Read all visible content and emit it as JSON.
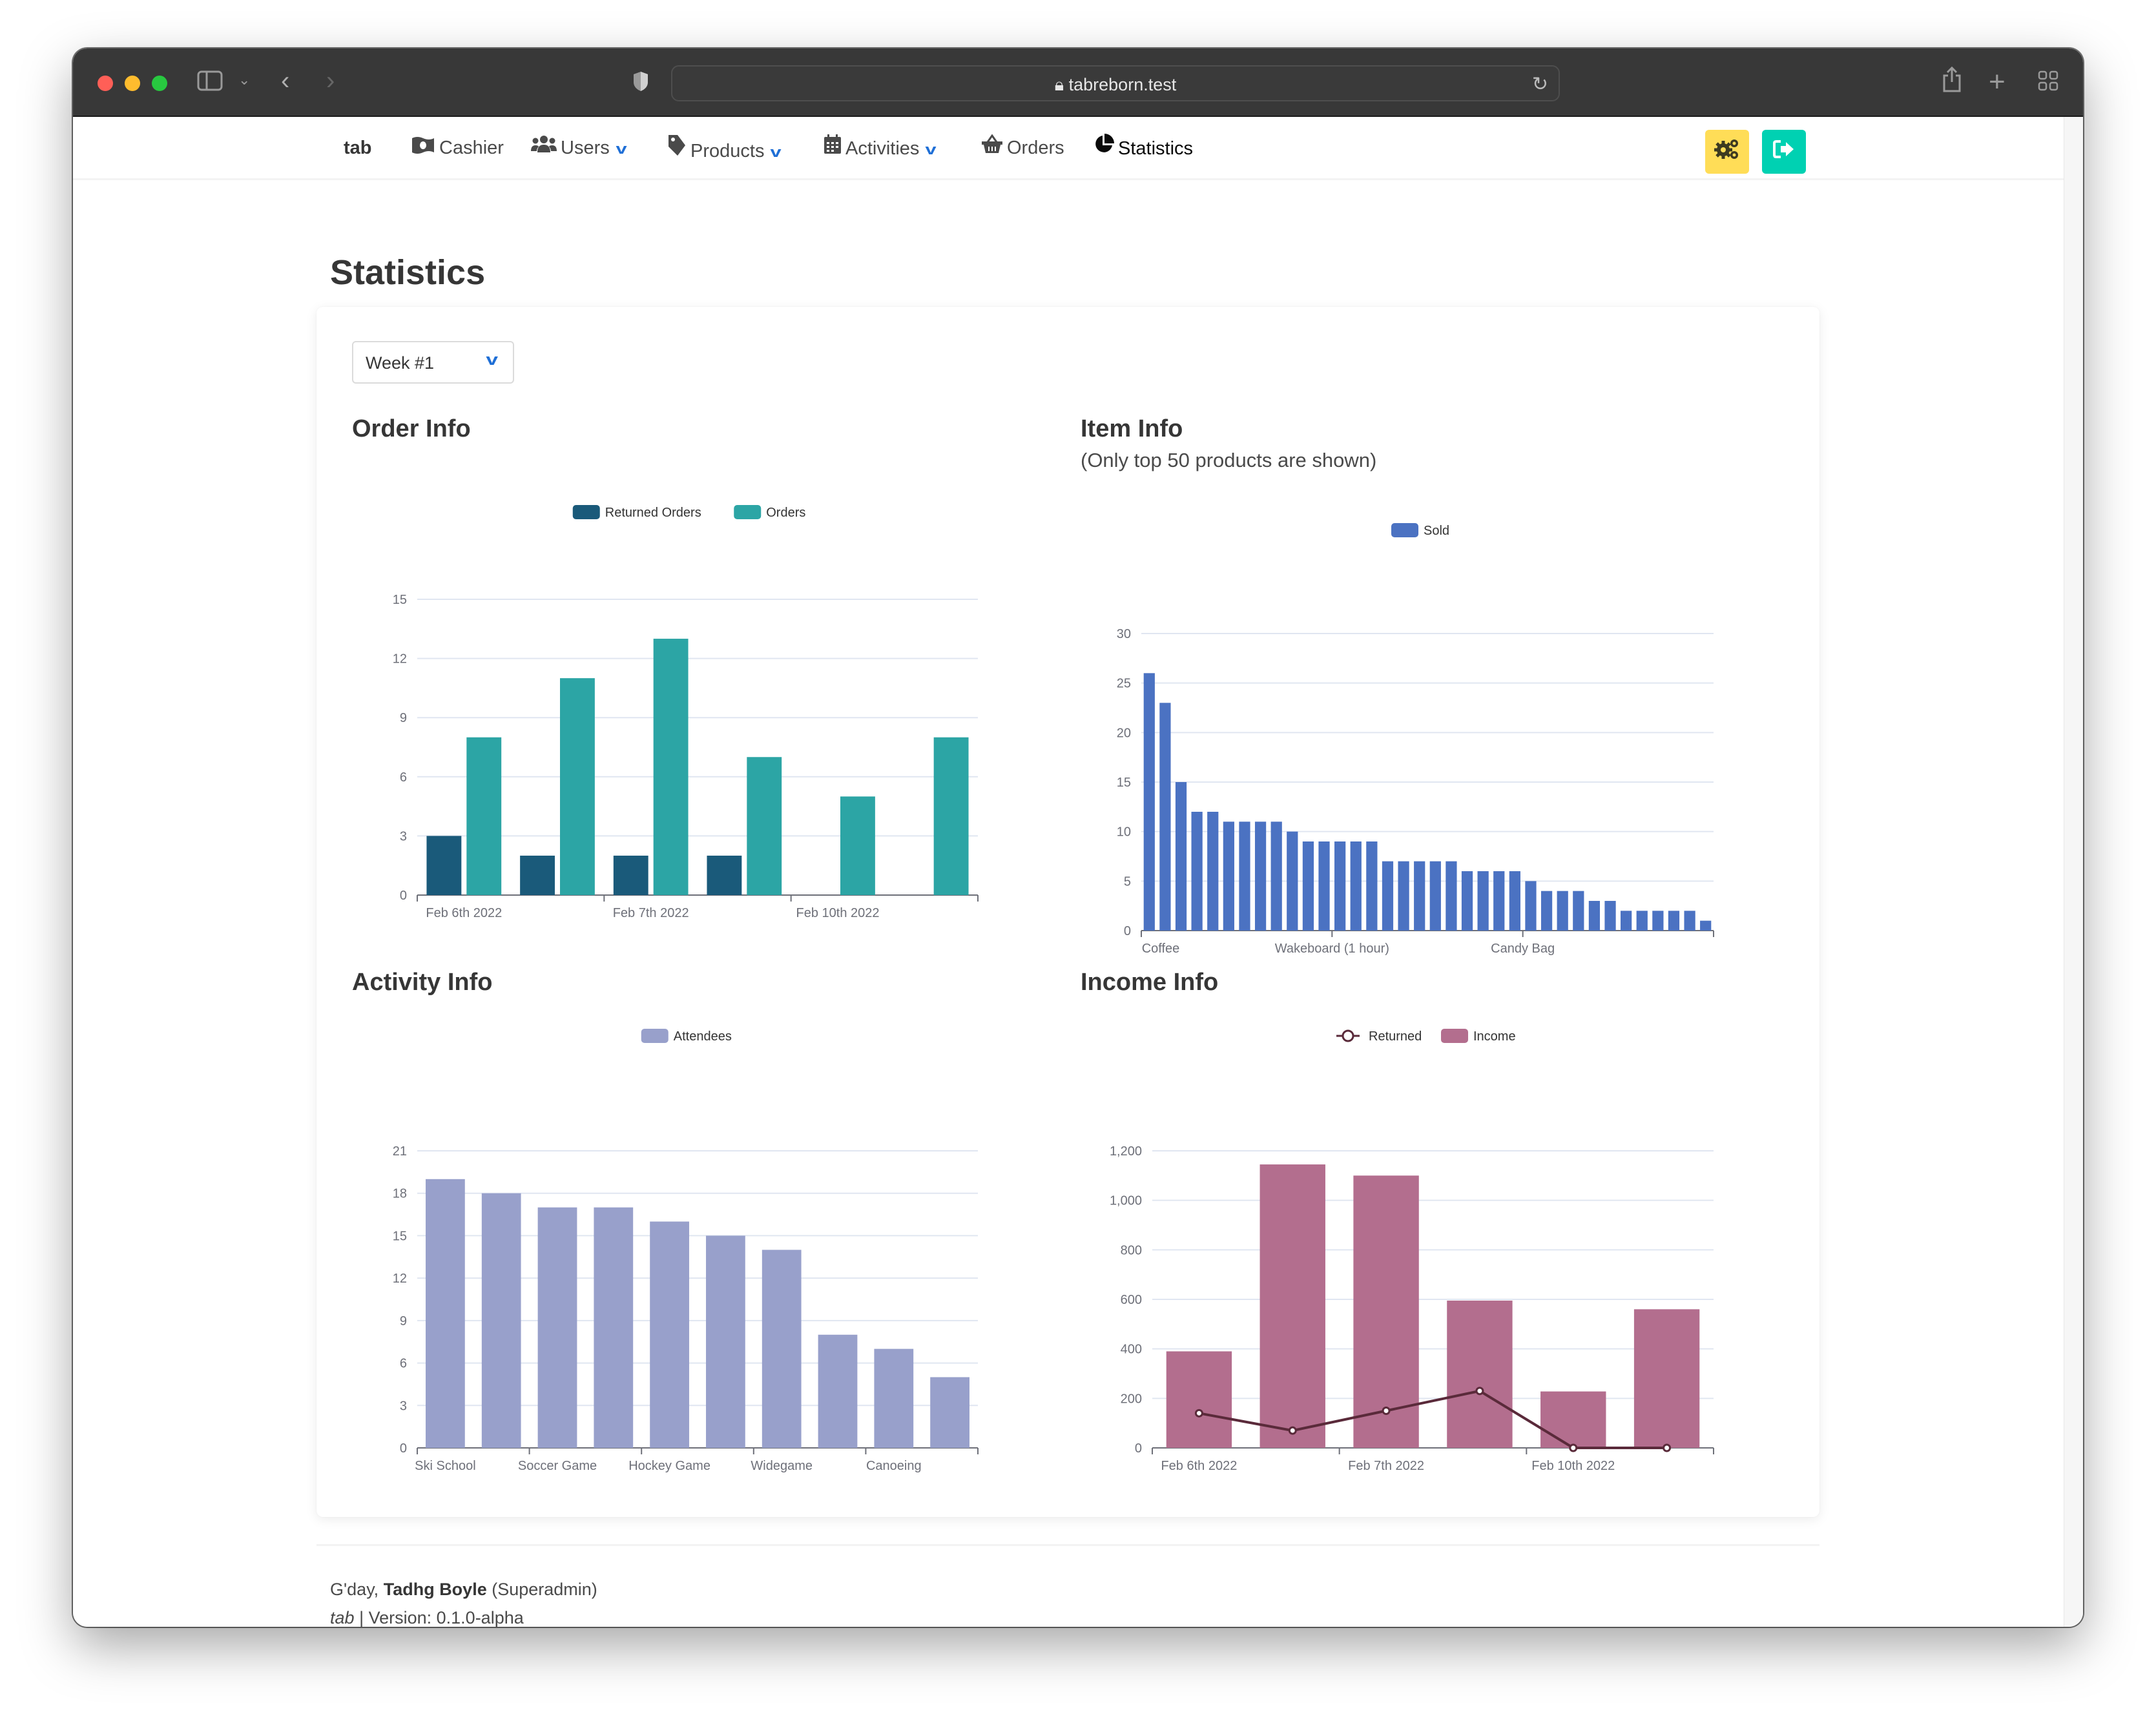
{
  "browser": {
    "url": "tabreborn.test",
    "icons": [
      "sidebar-icon",
      "chevron-down-icon",
      "back-icon",
      "forward-icon",
      "shield-icon",
      "lock-icon",
      "reload-icon",
      "share-icon",
      "new-tab-icon",
      "tab-overview-icon"
    ]
  },
  "nav": {
    "brand": "tab",
    "items": [
      {
        "label": "Cashier",
        "icon": "money-icon",
        "dropdown": false
      },
      {
        "label": "Users",
        "icon": "users-icon",
        "dropdown": true
      },
      {
        "label": "Products",
        "icon": "tag-icon",
        "dropdown": true
      },
      {
        "label": "Activities",
        "icon": "calendar-icon",
        "dropdown": true
      },
      {
        "label": "Orders",
        "icon": "basket-icon",
        "dropdown": false
      },
      {
        "label": "Statistics",
        "icon": "pie-chart-icon",
        "dropdown": false,
        "active": true
      }
    ],
    "settings_button": {
      "icon": "cogs-icon",
      "color": "#ffdd57"
    },
    "logout_button": {
      "icon": "sign-out-icon",
      "color": "#00d1b2"
    }
  },
  "page": {
    "title": "Statistics",
    "week_select": {
      "value": "Week #1"
    }
  },
  "sections": {
    "order": {
      "title": "Order Info"
    },
    "item": {
      "title": "Item Info",
      "subtitle": "(Only top 50 products are shown)"
    },
    "activity": {
      "title": "Activity Info"
    },
    "income": {
      "title": "Income Info"
    }
  },
  "chart_data": [
    {
      "id": "order",
      "type": "bar",
      "title": "Order Info",
      "categories": [
        "Feb 6th 2022",
        "",
        "Feb 7th 2022",
        "",
        "Feb 10th 2022",
        ""
      ],
      "series": [
        {
          "name": "Returned Orders",
          "color": "#1a5a7a",
          "values": [
            3,
            2,
            2,
            2,
            0,
            0
          ]
        },
        {
          "name": "Orders",
          "color": "#2ca5a5",
          "values": [
            8,
            11,
            13,
            7,
            5,
            8
          ]
        }
      ],
      "ylim": [
        0,
        15
      ],
      "yticks": [
        0,
        3,
        6,
        9,
        12,
        15
      ],
      "yticklabels": [
        "0",
        "3",
        "6",
        "9",
        "12",
        "15"
      ],
      "grid": true,
      "legend": "top-center"
    },
    {
      "id": "item",
      "type": "bar",
      "title": "Item Info",
      "categories_labeled": [
        "Coffee",
        "Wakeboard (1 hour)",
        "Candy Bag"
      ],
      "label_every": 12,
      "series": [
        {
          "name": "Sold",
          "color": "#4b72c2",
          "values": [
            26,
            23,
            15,
            12,
            12,
            11,
            11,
            11,
            11,
            10,
            9,
            9,
            9,
            9,
            9,
            7,
            7,
            7,
            7,
            7,
            6,
            6,
            6,
            6,
            5,
            4,
            4,
            4,
            3,
            3,
            2,
            2,
            2,
            2,
            2,
            1
          ]
        }
      ],
      "ylim": [
        0,
        30
      ],
      "yticks": [
        0,
        5,
        10,
        15,
        20,
        25,
        30
      ],
      "yticklabels": [
        "0",
        "5",
        "10",
        "15",
        "20",
        "25",
        "30"
      ],
      "grid": true,
      "legend": "top-center"
    },
    {
      "id": "activity",
      "type": "bar",
      "title": "Activity Info",
      "categories_labeled": [
        "Ski School",
        "Soccer Game",
        "Hockey Game",
        "Widegame",
        "Canoeing"
      ],
      "label_every": 2,
      "series": [
        {
          "name": "Attendees",
          "color": "#98a0cb",
          "values": [
            19,
            18,
            17,
            17,
            16,
            15,
            14,
            8,
            7,
            5
          ]
        }
      ],
      "ylim": [
        0,
        21
      ],
      "yticks": [
        0,
        3,
        6,
        9,
        12,
        15,
        18,
        21
      ],
      "yticklabels": [
        "0",
        "3",
        "6",
        "9",
        "12",
        "15",
        "18",
        "21"
      ],
      "grid": true,
      "legend": "top-center"
    },
    {
      "id": "income",
      "type": "bar",
      "title": "Income Info",
      "categories": [
        "Feb 6th 2022",
        "",
        "Feb 7th 2022",
        "",
        "Feb 10th 2022",
        ""
      ],
      "series": [
        {
          "name": "Returned",
          "kind": "line",
          "color": "#5a2a3a",
          "values": [
            140,
            70,
            150,
            230,
            0,
            0
          ]
        },
        {
          "name": "Income",
          "kind": "bar",
          "color": "#b36e8e",
          "values": [
            390,
            1145,
            1100,
            595,
            228,
            560
          ]
        }
      ],
      "ylim": [
        0,
        1200
      ],
      "yticks": [
        0,
        200,
        400,
        600,
        800,
        1000,
        1200
      ],
      "yticklabels": [
        "0",
        "200",
        "400",
        "600",
        "800",
        "1,000",
        "1,200"
      ],
      "grid": true,
      "legend": "top-center"
    }
  ],
  "footer": {
    "greeting": "G'day,",
    "user_name": "Tadhg Boyle",
    "role": "(Superadmin)",
    "app": "tab",
    "version": "| Version: 0.1.0-alpha"
  }
}
